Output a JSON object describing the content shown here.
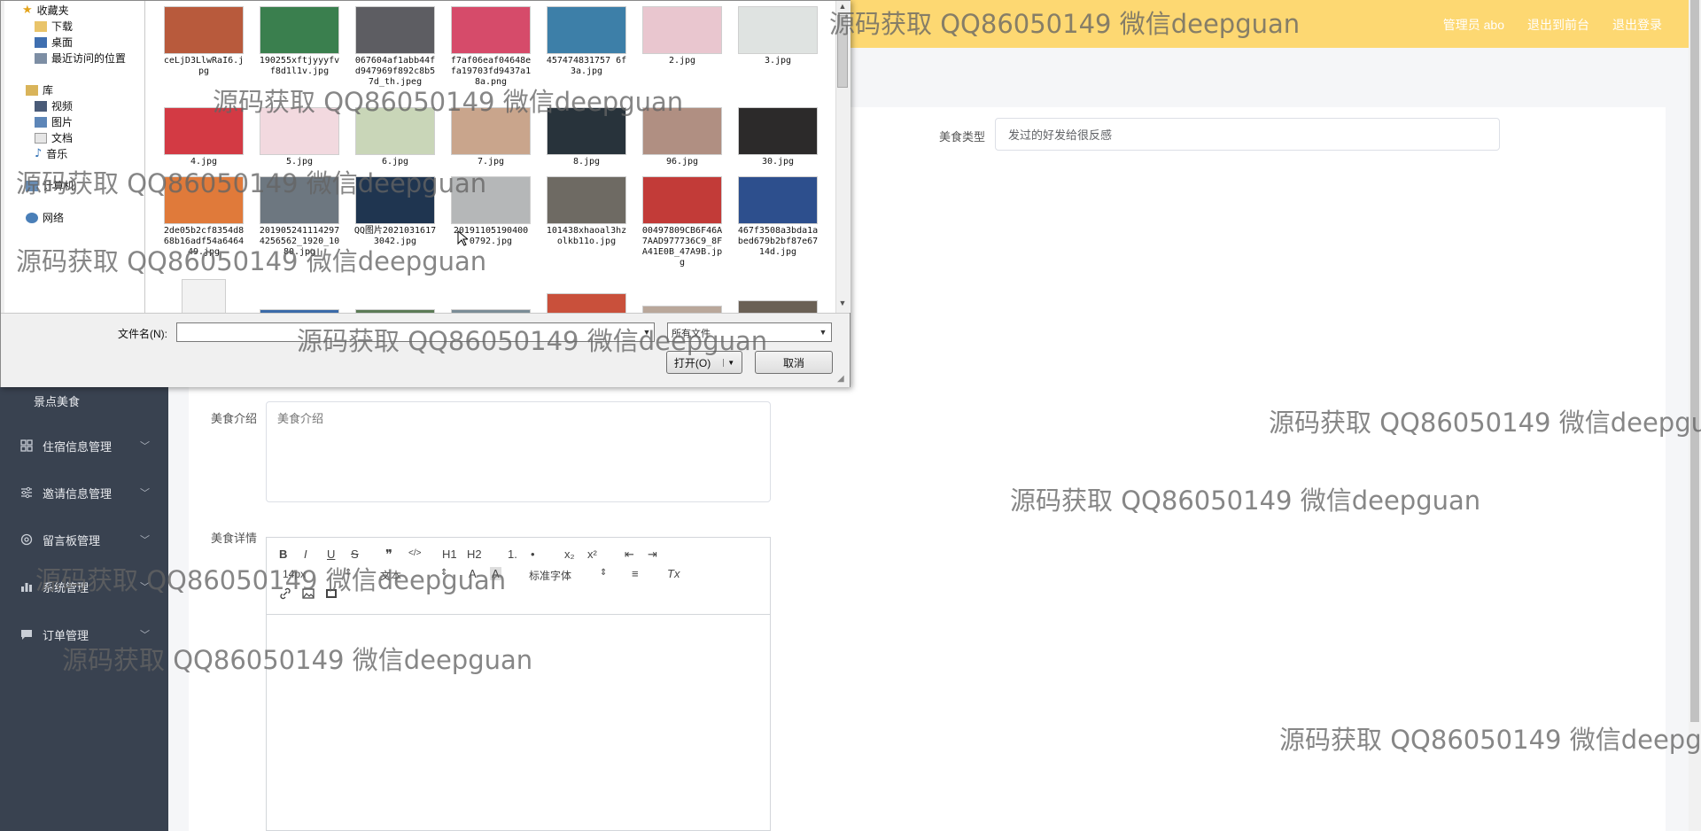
{
  "header": {
    "admin_label": "管理员 abo",
    "frontend_link": "退出到前台",
    "logout_link": "退出登录"
  },
  "sidebar": {
    "sub_item": "景点美食",
    "items": [
      {
        "label": "住宿信息管理",
        "icon": "grid-icon"
      },
      {
        "label": "邀请信息管理",
        "icon": "sliders-icon"
      },
      {
        "label": "留言板管理",
        "icon": "settings-icon"
      },
      {
        "label": "系统管理",
        "icon": "bar-chart-icon"
      },
      {
        "label": "订单管理",
        "icon": "chat-icon"
      }
    ]
  },
  "form": {
    "food_type_label": "美食类型",
    "food_type_value": "发过的好发给很反感",
    "intro_label": "美食介绍",
    "intro_placeholder": "美食介绍",
    "detail_label": "美食详情"
  },
  "editor": {
    "font_size": "14px",
    "font_family": "文本",
    "header_select": "标准字体",
    "buttons": [
      "B",
      "I",
      "U",
      "S",
      "❞",
      "</>",
      "H1",
      "H2",
      "1.",
      "•",
      "x₂",
      "x²",
      "⇤",
      "⇥",
      "A",
      "A",
      "≡",
      "Tx",
      "link",
      "image",
      "video"
    ]
  },
  "file_dialog": {
    "tree": {
      "favorites": "收藏夹",
      "downloads": "下载",
      "desktop": "桌面",
      "recent": "最近访问的位置",
      "libraries": "库",
      "videos": "视频",
      "pictures": "图片",
      "documents": "文档",
      "music": "音乐",
      "computer": "计算机",
      "network": "网络"
    },
    "files": [
      {
        "name": "ceLjD3LlwRaI6.jpg",
        "color": "#b85a3c"
      },
      {
        "name": "190255xftjyyyfvf8d1l1v.jpg",
        "color": "#3a7f4e"
      },
      {
        "name": "067604af1abb44fd947969f892c8b57d_th.jpeg",
        "color": "#5d5d62"
      },
      {
        "name": "f7af06eaf04648efa19703fd9437a18a.png",
        "color": "#d64b6a"
      },
      {
        "name": "457474831757 6f3a.jpg",
        "color": "#3d7fa8"
      },
      {
        "name": "2.jpg",
        "color": "#e9c6cf"
      },
      {
        "name": "3.jpg",
        "color": "#dfe3e1"
      },
      {
        "name": "4.jpg",
        "color": "#d33a44"
      },
      {
        "name": "5.jpg",
        "color": "#f2d9df"
      },
      {
        "name": "6.jpg",
        "color": "#c9d6b8"
      },
      {
        "name": "7.jpg",
        "color": "#c9a58c"
      },
      {
        "name": "8.jpg",
        "color": "#28333b"
      },
      {
        "name": "96.jpg",
        "color": "#b08f82"
      },
      {
        "name": "30.jpg",
        "color": "#2c2a2a"
      },
      {
        "name": "2de05b2cf8354d868b16adf54a646449.jpg",
        "color": "#e07a3a"
      },
      {
        "name": "201905241114297 4256562_1920_1080.jpg",
        "color": "#6d7780"
      },
      {
        "name": "QQ图片20210316173042.jpg",
        "color": "#1f3550"
      },
      {
        "name": "20191105190400 0792.jpg",
        "color": "#b5b7b8"
      },
      {
        "name": "101438xhaoal3hzolkb11o.jpg",
        "color": "#6e6a63"
      },
      {
        "name": "00497809CB6F46A7AAD977736C9_8FA41E0B_47A9B.jpg",
        "color": "#c23b38"
      },
      {
        "name": "467f3508a3bda1abed679b2bf87e6714d.jpg",
        "color": "#2d4f8d"
      }
    ],
    "partial_files": [
      {
        "color": "#f2f2f2"
      },
      {
        "color": "#3a6aa8"
      },
      {
        "color": "#5b7a55"
      },
      {
        "color": "#7a8c96"
      },
      {
        "color": "#c9503b"
      },
      {
        "color": "#b9a79a"
      },
      {
        "color": "#6a6055"
      }
    ],
    "filename_label": "文件名(N):",
    "filename_value": "",
    "filetype_value": "所有文件",
    "open_button": "打开(O)",
    "cancel_button": "取消"
  },
  "watermarks": [
    "源码获取 QQ86050149 微信deepguan",
    "源码获取 QQ86050149 微信deepguan",
    "源码获取 QQ86050149 微信deepguan",
    "源码获取 QQ86050149 微信deepguan",
    "源码获取 QQ86050149 微信deepguan",
    "源码获取 QQ86050149 微信deepgu",
    "源码获取 QQ86050149 微信deepguan",
    "源码获取 QQ86050149 微信deepguan",
    "源码获取 QQ86050149 微信deepguan",
    "源码获取 QQ86050149 微信deepg"
  ],
  "colors": {
    "header_bg": "#fdd872",
    "sidebar_bg": "#394250"
  }
}
